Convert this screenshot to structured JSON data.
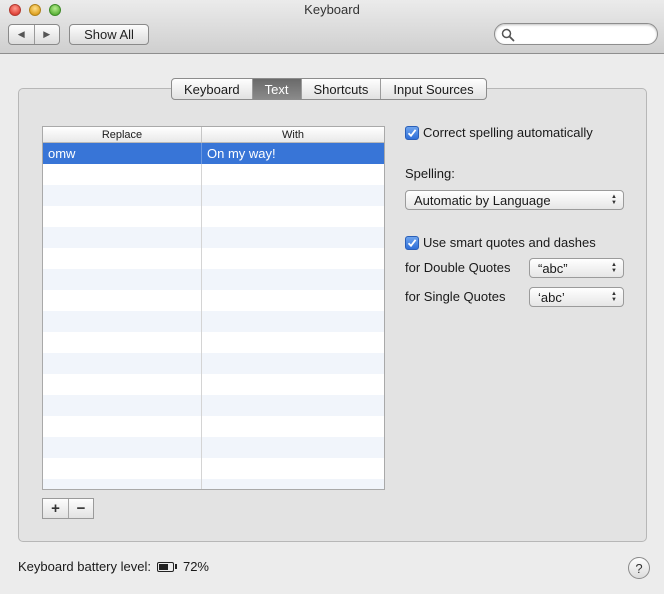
{
  "window": {
    "title": "Keyboard",
    "nav_back": "◀",
    "nav_forward": "▶",
    "show_all": "Show All",
    "search_placeholder": "",
    "search_value": ""
  },
  "tabs": [
    {
      "label": "Keyboard",
      "active": false
    },
    {
      "label": "Text",
      "active": true
    },
    {
      "label": "Shortcuts",
      "active": false
    },
    {
      "label": "Input Sources",
      "active": false
    }
  ],
  "replacements": {
    "headers": [
      "Replace",
      "With"
    ],
    "rows": [
      {
        "replace": "omw",
        "with": "On my way!",
        "selected": true
      }
    ]
  },
  "controls": {
    "add": "+",
    "remove": "−"
  },
  "options": {
    "correct_spelling": {
      "label": "Correct spelling automatically",
      "checked": true
    },
    "spelling_label": "Spelling:",
    "spelling_value": "Automatic by Language",
    "smart_quotes": {
      "label": "Use smart quotes and dashes",
      "checked": true
    },
    "double_quotes_label": "for Double Quotes",
    "double_quotes_value": "“abc”",
    "single_quotes_label": "for Single Quotes",
    "single_quotes_value": "‘abc’"
  },
  "footer": {
    "battery_label": "Keyboard battery level:",
    "battery_percent": "72%",
    "battery_level": 0.72,
    "help": "?"
  },
  "colors": {
    "selection": "#3875d7",
    "checkbox": "#2f6fd8",
    "active_tab": "#777777"
  }
}
